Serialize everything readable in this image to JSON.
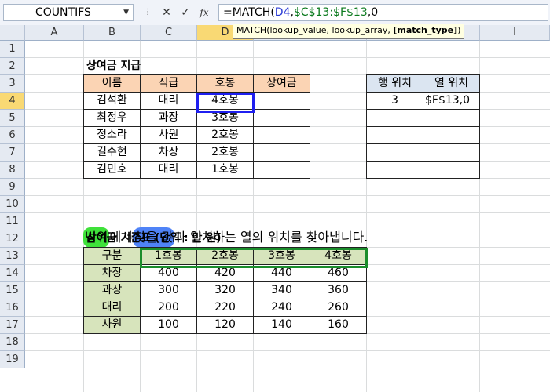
{
  "formula_bar": {
    "name_box": "COUNTIFS",
    "cancel_glyph": "✕",
    "enter_glyph": "✓",
    "fx_label": "fx",
    "formula_prefix": "=MATCH(",
    "formula_ref1": "D4",
    "formula_comma": ",",
    "formula_ref2": "$C$13:$F$13",
    "formula_suffix": ",0",
    "tooltip_prefix": "MATCH(lookup_value, lookup_array, ",
    "tooltip_bold": "[match_type]",
    "tooltip_suffix": ")"
  },
  "columns": [
    "A",
    "B",
    "C",
    "D",
    "E",
    "F",
    "G",
    "H",
    "I"
  ],
  "rows": [
    "1",
    "2",
    "3",
    "4",
    "5",
    "6",
    "7",
    "8",
    "9",
    "10",
    "11",
    "12",
    "13",
    "14",
    "15",
    "16",
    "17",
    "18",
    "19"
  ],
  "table1": {
    "title": "상여금 지급",
    "headers": [
      "이름",
      "직급",
      "호봉",
      "상여금"
    ],
    "rows": [
      [
        "김석환",
        "대리",
        "4호봉",
        ""
      ],
      [
        "최정우",
        "과장",
        "3호봉",
        ""
      ],
      [
        "정소라",
        "사원",
        "2호봉",
        ""
      ],
      [
        "길수현",
        "차장",
        "2호봉",
        ""
      ],
      [
        "김민호",
        "대리",
        "1호봉",
        ""
      ]
    ]
  },
  "table2": {
    "headers": [
      "행 위치",
      "열 위치"
    ],
    "row1": [
      "3",
      "$F$13,0"
    ]
  },
  "annotation": {
    "part1": "범위",
    "part2": " 에서 ",
    "part3": "찾을 값",
    "part4": " 과 일치하는 열의 위치를 찾아냅니다."
  },
  "table3": {
    "title": "상여금 기준표 (단위 : 만 원)",
    "headers": [
      "구분",
      "1호봉",
      "2호봉",
      "3호봉",
      "4호봉"
    ],
    "rows": [
      [
        "차장",
        "400",
        "420",
        "440",
        "460"
      ],
      [
        "과장",
        "300",
        "320",
        "340",
        "360"
      ],
      [
        "대리",
        "200",
        "220",
        "240",
        "260"
      ],
      [
        "사원",
        "100",
        "120",
        "140",
        "160"
      ]
    ]
  },
  "colors": {
    "table1_header": "#fbd4b4",
    "table2_header": "#dbe5f1",
    "table3_header": "#d7e4bc",
    "lookup_value_border": "#1f1ff0",
    "lookup_range_border": "#1b8d2c"
  },
  "icons": {
    "name_box_dropdown": "chevron-down-icon",
    "cancel": "close-icon",
    "enter": "check-icon",
    "insert_function": "fx-icon"
  }
}
